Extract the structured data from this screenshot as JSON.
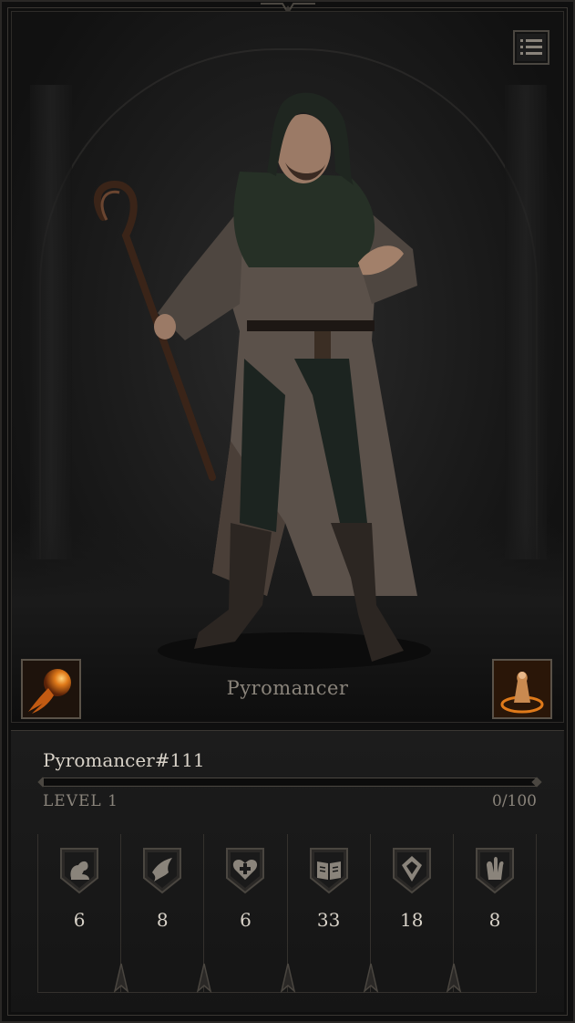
{
  "character": {
    "class_name": "Pyromancer"
  },
  "player": {
    "name": "Pyromancer#111",
    "level_label": "LEVEL",
    "level": "1",
    "xp_text": "0/100",
    "xp_fraction": 0
  },
  "skills": {
    "left": "fireball-icon",
    "right": "summon-icon"
  },
  "menu": {
    "icon": "list-menu-icon"
  },
  "stats": [
    {
      "icon": "strength-icon",
      "value": "6"
    },
    {
      "icon": "agility-icon",
      "value": "8"
    },
    {
      "icon": "vitality-icon",
      "value": "6"
    },
    {
      "icon": "knowledge-icon",
      "value": "33"
    },
    {
      "icon": "will-icon",
      "value": "18"
    },
    {
      "icon": "resourcefulness-icon",
      "value": "8"
    }
  ],
  "colors": {
    "accent_text": "#d8d2c8",
    "muted_text": "#8a847b",
    "frame": "#4a4640",
    "fire": "#e07a1a"
  }
}
